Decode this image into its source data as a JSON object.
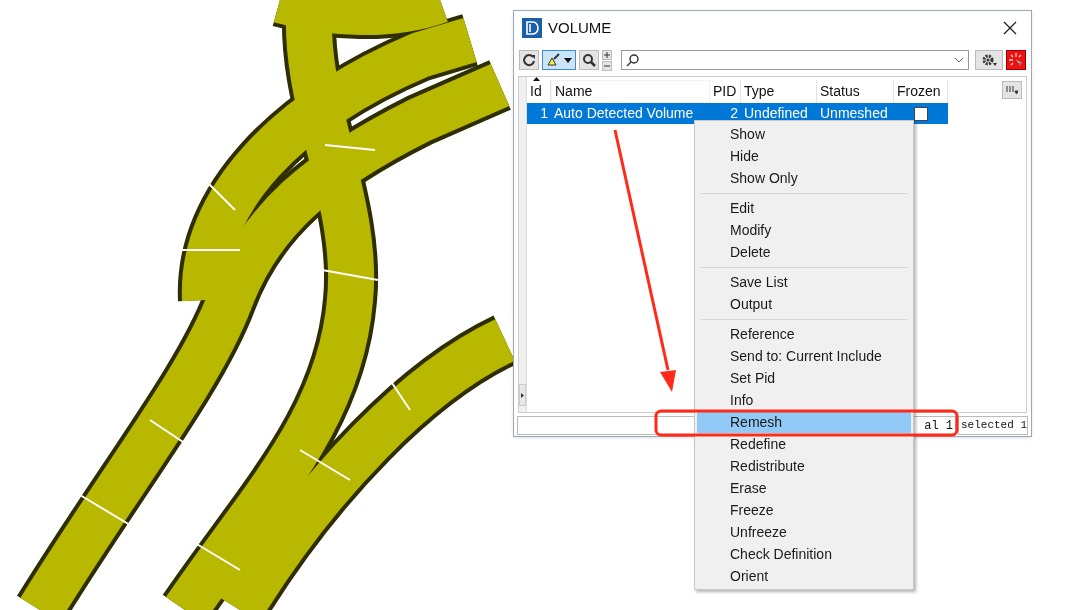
{
  "window": {
    "title": "VOLUME"
  },
  "toolbar": {
    "highlight_pressed": true
  },
  "table": {
    "columns": [
      "Id",
      "Name",
      "PID",
      "Type",
      "Status",
      "Frozen"
    ],
    "rows": [
      {
        "cells": [
          "1",
          "Auto Detected Volume",
          "2",
          "Undefined",
          "Unmeshed"
        ],
        "frozen": false,
        "selected": true
      }
    ]
  },
  "status_bar": [
    "al 1",
    "selected 1"
  ],
  "context_menu": {
    "groups": [
      [
        {
          "label": "Show",
          "selected": false
        },
        {
          "label": "Hide",
          "selected": false
        },
        {
          "label": "Show Only",
          "selected": false
        }
      ],
      [
        {
          "label": "Edit",
          "selected": false
        },
        {
          "label": "Modify",
          "selected": false
        },
        {
          "label": "Delete",
          "selected": false
        }
      ],
      [
        {
          "label": "Save List",
          "selected": false
        },
        {
          "label": "Output",
          "selected": false
        }
      ],
      [
        {
          "label": "Reference",
          "selected": false
        },
        {
          "label": "Send to: Current Include",
          "selected": false
        },
        {
          "label": "Set Pid",
          "selected": false
        },
        {
          "label": "Info",
          "selected": false
        },
        {
          "label": "Remesh",
          "selected": true
        },
        {
          "label": "Redefine",
          "selected": false
        },
        {
          "label": "Redistribute",
          "selected": false
        },
        {
          "label": "Erase",
          "selected": false
        },
        {
          "label": "Freeze",
          "selected": false
        },
        {
          "label": "Unfreeze",
          "selected": false
        },
        {
          "label": "Check Definition",
          "selected": false
        },
        {
          "label": "Orient",
          "selected": false
        }
      ]
    ]
  }
}
